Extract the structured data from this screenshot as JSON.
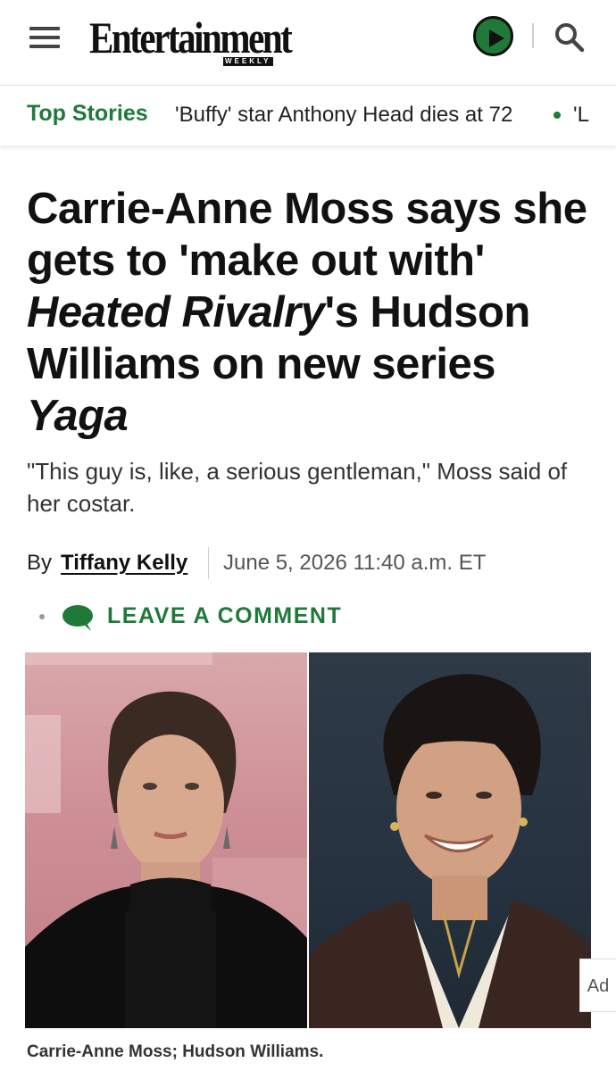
{
  "header": {
    "menu_icon": "hamburger-menu-icon",
    "logo_text": "Entertainment",
    "logo_subtext": "WEEKLY",
    "play_icon": "play-icon",
    "search_icon": "search-icon",
    "accent_color": "#1f7a3a"
  },
  "topbar": {
    "label": "Top Stories",
    "story": "'Buffy' star Anthony Head dies at 72",
    "next_story_fragment": "'L"
  },
  "article": {
    "headline_part1": "Carrie-Anne Moss says she gets to 'make out with' ",
    "headline_italic1": "Heated Rivalry",
    "headline_part2": "'s Hudson Williams on new series ",
    "headline_italic2": "Yaga",
    "dek": "\"This guy is, like, a serious gentleman,\" Moss said of her costar.",
    "byline_prefix": "By",
    "author": "Tiffany Kelly",
    "date": "June 5, 2026 11:40 a.m. ET",
    "comment_label": "LEAVE A COMMENT",
    "comment_icon": "comment-bubble-icon",
    "caption": "Carrie-Anne Moss; Hudson Williams.",
    "ad_label": "Ad"
  }
}
